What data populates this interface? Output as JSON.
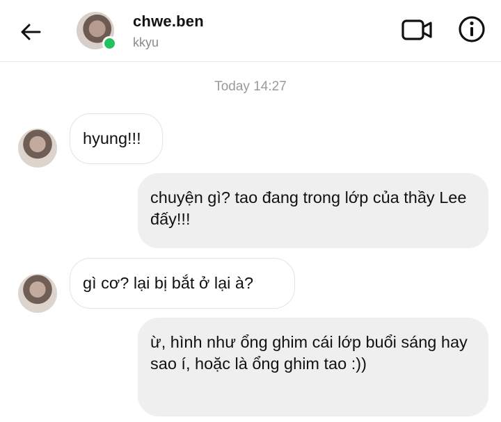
{
  "header": {
    "name": "chwe.ben",
    "subname": "kkyu",
    "back_icon": "arrow-left-icon",
    "video_icon": "video-call-icon",
    "info_icon": "info-icon",
    "online_color": "#22c35e"
  },
  "chat": {
    "timestamp": "Today 14:27",
    "messages": [
      {
        "direction": "received",
        "text": "hyung!!!"
      },
      {
        "direction": "sent",
        "text": "chuyện gì? tao đang trong lớp của thầy Lee đấy!!!"
      },
      {
        "direction": "received",
        "text": "gì cơ? lại bị bắt ở lại à?"
      },
      {
        "direction": "sent",
        "text": "ừ, hình như ổng ghim cái lớp buổi sáng hay sao í, hoặc là ổng ghim tao :))"
      }
    ]
  }
}
